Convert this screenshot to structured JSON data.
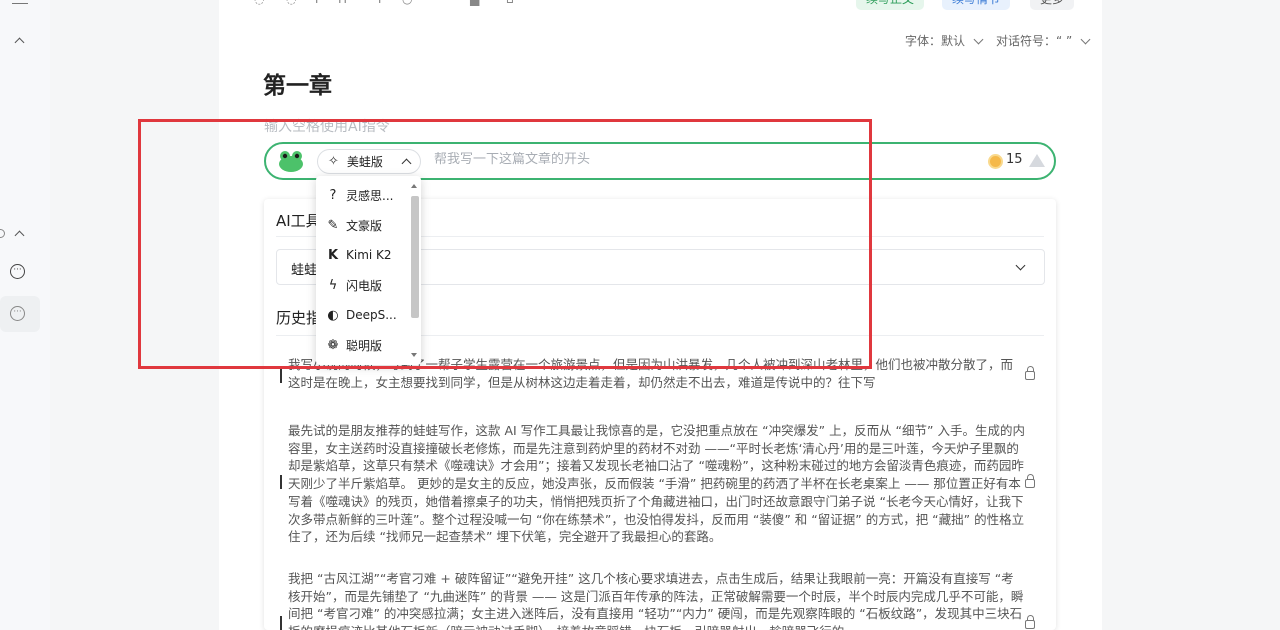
{
  "settings": {
    "font_label": "字体：默认",
    "quote_label": "对话符号：“ ”"
  },
  "toolbar": {
    "btn_green": "续写正文",
    "btn_blue": "续写情节",
    "btn_more": "更多"
  },
  "chapter": {
    "title": "第一章",
    "hint": "输入空格使用AI指令"
  },
  "ai_bar": {
    "model": "美蛙版",
    "input_placeholder": "帮我写一下这篇文章的开头",
    "credits": "15"
  },
  "model_menu": [
    {
      "icon": "lightbulb-icon",
      "glyph": "?",
      "label": "灵感思..."
    },
    {
      "icon": "pen-icon",
      "glyph": "✎",
      "label": "文豪版"
    },
    {
      "icon": "kimi-icon",
      "glyph": "K",
      "label": "Kimi K2"
    },
    {
      "icon": "lightning-icon",
      "glyph": "ϟ",
      "label": "闪电版"
    },
    {
      "icon": "whale-icon",
      "glyph": "◐",
      "label": "DeepS..."
    },
    {
      "icon": "brain-icon",
      "glyph": "❁",
      "label": "聪明版"
    }
  ],
  "panel": {
    "title": "AI工具",
    "tool_value": "蛙蛙",
    "history_title": "历史指令"
  },
  "history": [
    "我写小说的时候，写到了一帮子学生露营在一个旅游景点，但是因为山洪暴发，几个人被冲到深山老林里，他们也被冲散分散了，而这时是在晚上，女主想要找到同学，但是从树林这边走着走着，却仍然走不出去，难道是传说中的？往下写",
    "最先试的是朋友推荐的蛙蛙写作，这款 AI 写作工具最让我惊喜的是，它没把重点放在 “冲突爆发” 上，反而从 “细节” 入手。生成的内容里，女主送药时没直接撞破长老修炼，而是先注意到药炉里的药材不对劲 ——“平时长老炼‘清心丹’用的是三叶莲，今天炉子里飘的却是紫焰草，这草只有禁术《噬魂诀》才会用”；接着又发现长老袖口沾了 “噬魂粉”，这种粉末碰过的地方会留淡青色痕迹，而药园昨天刚少了半斤紫焰草。 更妙的是女主的反应，她没声张，反而假装 “手滑” 把药碗里的药洒了半杯在长老桌案上 —— 那位置正好有本写着《噬魂诀》的残页，她借着擦桌子的功夫，悄悄把残页折了个角藏进袖口，出门时还故意跟守门弟子说 “长老今天心情好，让我下次多带点新鲜的三叶莲”。整个过程没喊一句 “你在练禁术”，也没怕得发抖，反而用 “装傻” 和 “留证据” 的方式，把 “藏拙” 的性格立住了，还为后续 “找师兄一起查禁术” 埋下伏笔，完全避开了我最担心的套路。",
    "我把 “古风江湖”“考官刁难 + 破阵留证”“避免开挂” 这几个核心要求填进去，点击生成后，结果让我眼前一亮：开篇没有直接写 “考核开始”，而是先铺垫了 “九曲迷阵” 的背景 —— 这是门派百年传承的阵法，正常破解需要一个时辰，半个时辰内完成几乎不可能，瞬间把 “考官刁难” 的冲突感拉满；女主进入迷阵后，没有直接用 “轻功”“内力” 硬闯，而是先观察阵眼的 “石板纹路”，发现其中三块石板的磨损痕迹比其他石板新（暗示被动过手脚），接着故意踩错一块石板，引暗器射出，趁暗器飞行的"
  ]
}
